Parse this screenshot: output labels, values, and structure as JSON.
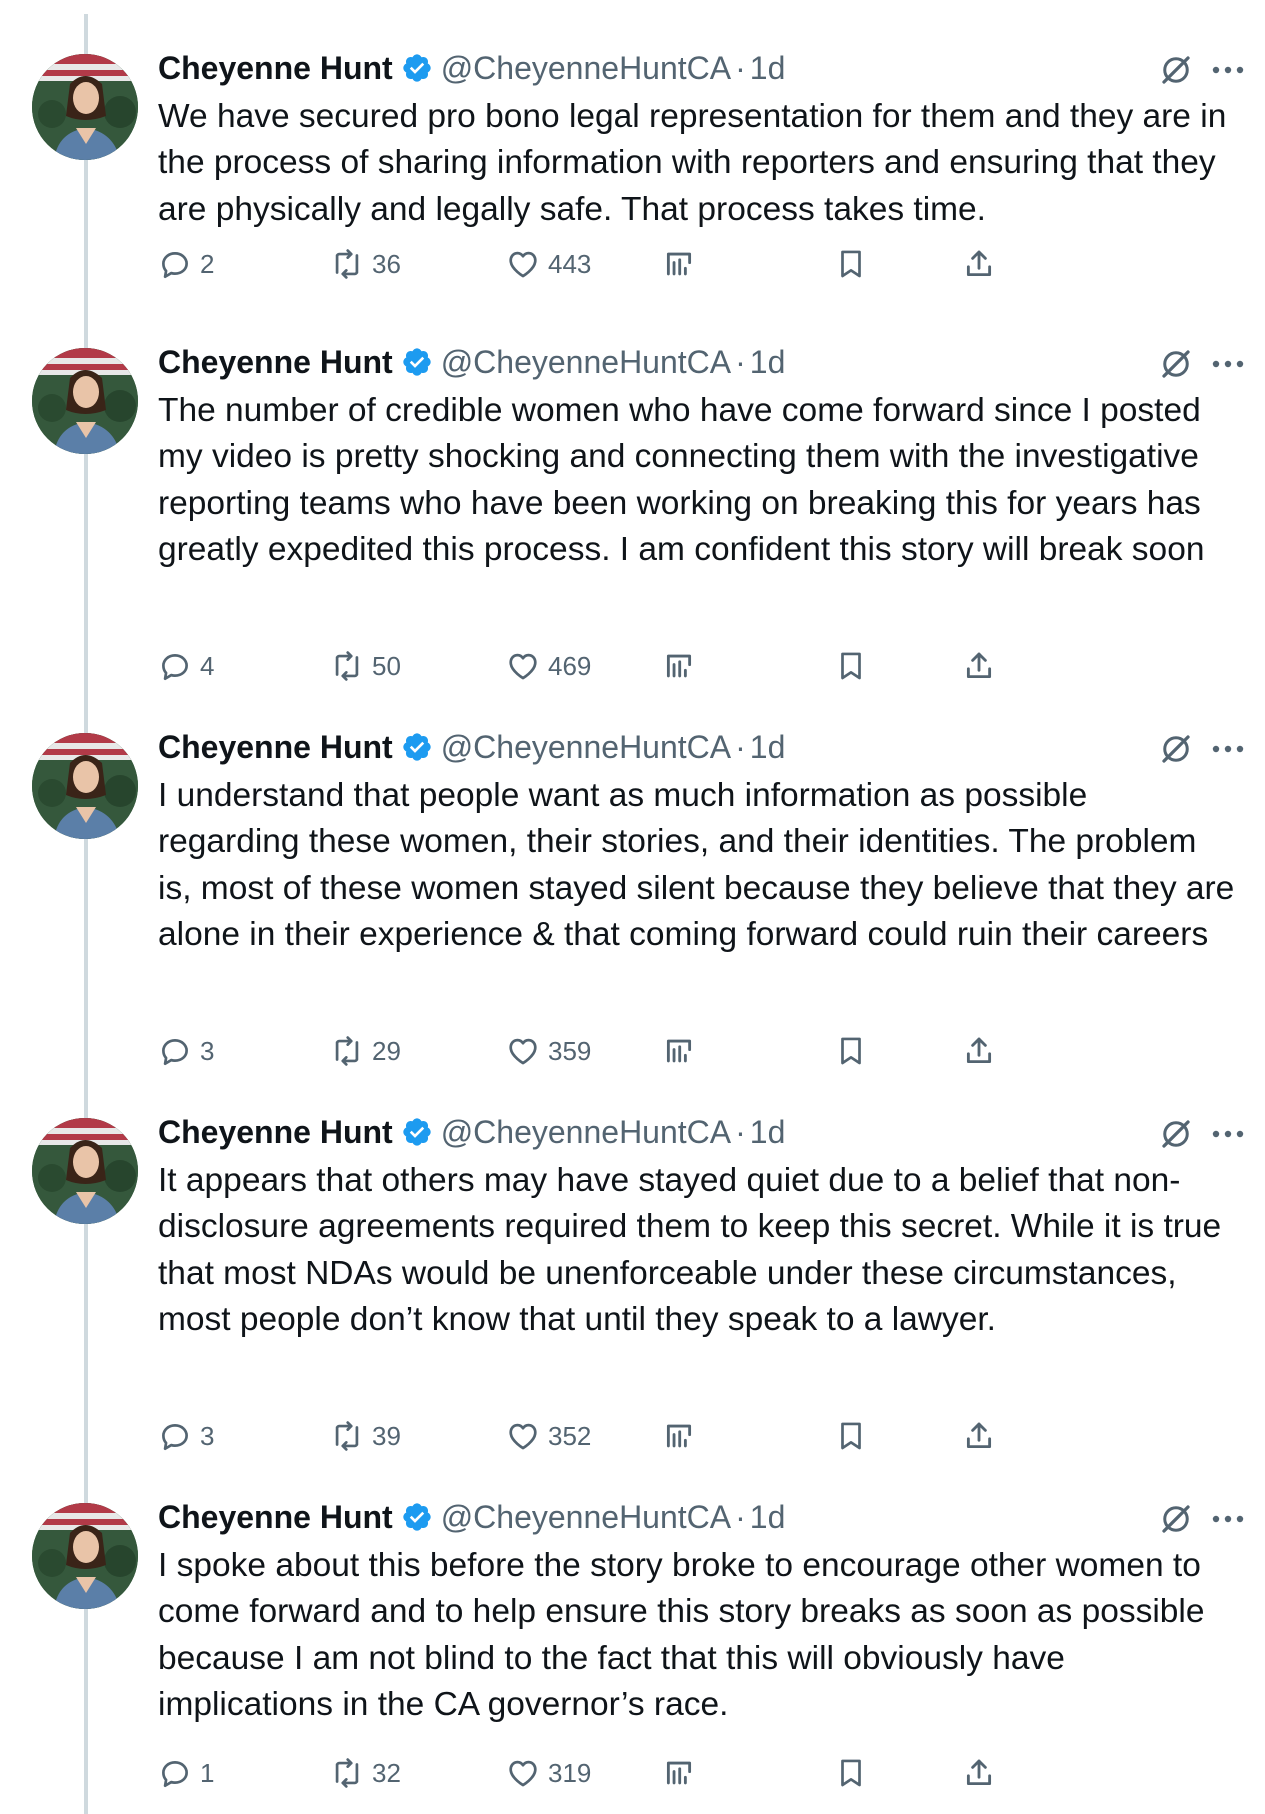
{
  "tweets": [
    {
      "name": "Cheyenne Hunt",
      "handle": "@CheyenneHuntCA",
      "dot": "·",
      "time": "1d",
      "text": "We have secured pro bono legal representation for them and they are in the process of sharing information with reporters and ensuring that they are physically and legally safe. That process takes time.",
      "replies": "2",
      "reposts": "36",
      "likes": "443"
    },
    {
      "name": "Cheyenne Hunt",
      "handle": "@CheyenneHuntCA",
      "dot": "·",
      "time": "1d",
      "text": "The number of credible women who have come forward since I posted my video is pretty shocking and connecting them with the investigative reporting teams who have been working on breaking this for years has greatly expedited this process. I am confident this story will break soon",
      "replies": "4",
      "reposts": "50",
      "likes": "469"
    },
    {
      "name": "Cheyenne Hunt",
      "handle": "@CheyenneHuntCA",
      "dot": "·",
      "time": "1d",
      "text": "I understand that people want as much information as possible regarding these women, their stories, and their identities. The problem is, most of these women stayed silent because they believe that they are alone in their experience & that coming forward could ruin their careers",
      "replies": "3",
      "reposts": "29",
      "likes": "359"
    },
    {
      "name": "Cheyenne Hunt",
      "handle": "@CheyenneHuntCA",
      "dot": "·",
      "time": "1d",
      "text": "It appears that others may have stayed quiet due to a belief that non-disclosure agreements required them to keep this secret. While it is true that most NDAs would be unenforceable under these circumstances, most people don’t know that until they speak to a lawyer.",
      "replies": "3",
      "reposts": "39",
      "likes": "352"
    },
    {
      "name": "Cheyenne Hunt",
      "handle": "@CheyenneHuntCA",
      "dot": "·",
      "time": "1d",
      "text": "I spoke about this before the story broke to encourage other women to come forward and to help ensure this story breaks as soon as possible because I am not blind to the fact that this will obviously have implications in the CA governor’s race.",
      "replies": "1",
      "reposts": "32",
      "likes": "319"
    }
  ],
  "icons": {
    "reply": "reply-icon",
    "repost": "repost-icon",
    "like": "like-icon",
    "views": "views-icon",
    "bookmark": "bookmark-icon",
    "share": "share-icon",
    "grok": "grok-icon",
    "more": "more-icon",
    "verified": "verified-badge-icon"
  },
  "colors": {
    "verified": "#1d9bf0",
    "secondary_text": "#536471",
    "primary_text": "#0f1419",
    "thread_line": "#cfd9de"
  }
}
